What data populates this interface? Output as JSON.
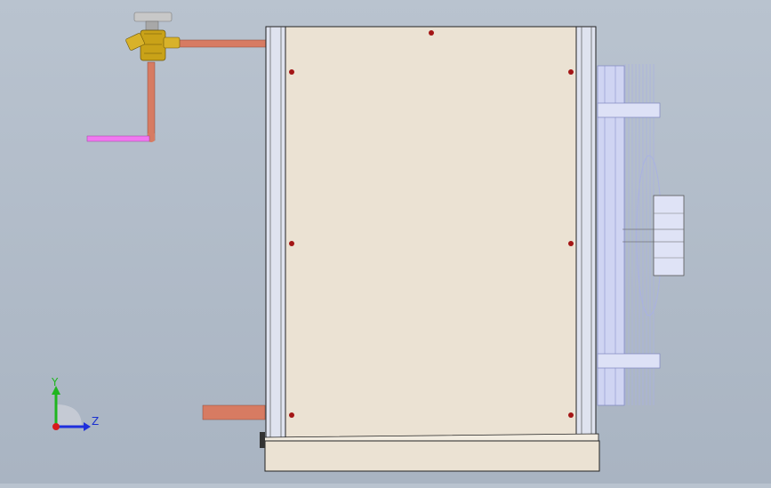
{
  "viewport": {
    "background_top": "#b9c3cf",
    "background_bottom": "#a9b4c2"
  },
  "model": {
    "cabinet_panel_color": "#ebe2d3",
    "frame_color": "#dfe3ef",
    "bolt_color": "#a31515",
    "copper_pipe_color": "#d77b62",
    "purple_pipe_color": "#f078f0",
    "valve_color": "#c9a218",
    "fan_guard_color": "#cfd4f2"
  },
  "triad": {
    "y_label": "Y",
    "z_label": "Z",
    "y_axis_color": "#1fb51f",
    "z_axis_color": "#1f2fdc",
    "origin_color": "#d81b1b"
  }
}
